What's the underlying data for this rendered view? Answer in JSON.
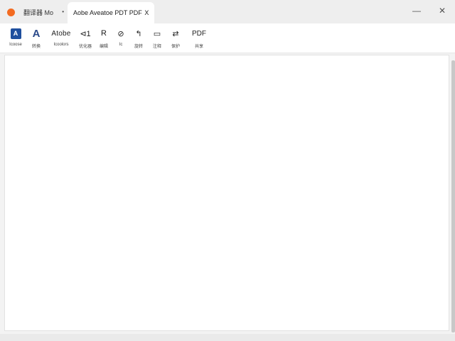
{
  "tabs": {
    "inactive": {
      "label": "翻译器 Mo",
      "menu_glyph": "•"
    },
    "active": {
      "label": "Aobe Aveatoe PDT PDF",
      "close_glyph": "X"
    }
  },
  "window_controls": {
    "minimize": "—",
    "close": "✕"
  },
  "toolbar": {
    "items": [
      {
        "label": "Icoose",
        "icon_text": "A"
      },
      {
        "label": "转换",
        "icon_text": "A"
      },
      {
        "label": "Icoolors",
        "icon_text": "Atobe"
      },
      {
        "label": "优化器",
        "icon_text": "⊲1"
      },
      {
        "label": "编辑",
        "icon_text": "R"
      },
      {
        "label": "Ic",
        "icon_text": "⊘"
      },
      {
        "label": "旋转",
        "icon_text": "↰"
      },
      {
        "label": "注释",
        "icon_text": "▭"
      },
      {
        "label": "保护",
        "icon_text": "⇄"
      },
      {
        "label": "共享",
        "icon_text": "PDF"
      }
    ]
  },
  "colors": {
    "app_accent": "#f36b21",
    "brand_blue": "#1f4f9e",
    "page_background": "#ffffff"
  }
}
